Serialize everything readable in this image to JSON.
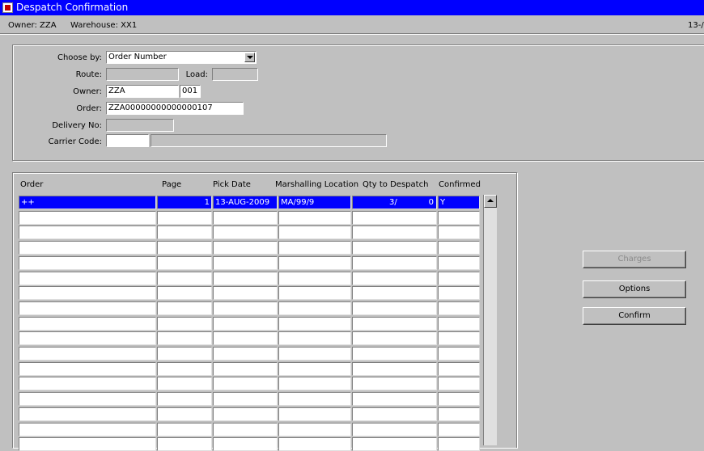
{
  "window": {
    "title": "Despatch Confirmation"
  },
  "info": {
    "owner_text": "Owner: ZZA",
    "warehouse_text": "Warehouse: XX1",
    "date_fragment": "13-/"
  },
  "form": {
    "choose_by_label": "Choose by:",
    "choose_by_value": "Order Number",
    "route_label": "Route:",
    "route_value": "",
    "load_label": "Load:",
    "load_value": "",
    "owner_label": "Owner:",
    "owner_value": "ZZA",
    "owner_code": "001",
    "order_label": "Order:",
    "order_value": "ZZA00000000000000107",
    "delivery_label": "Delivery No:",
    "delivery_value": "",
    "carrier_label": "Carrier Code:",
    "carrier_code": "",
    "carrier_desc": ""
  },
  "table": {
    "headers": [
      "Order",
      "Page",
      "Pick Date",
      "Marshalling Location",
      "Qty to Despatch",
      "Confirmed"
    ],
    "rows": [
      {
        "order": "++",
        "page": "1",
        "pick_date": "13-AUG-2009",
        "location": "MA/99/9",
        "qty": "3/",
        "qty2": "0",
        "confirmed": "Y"
      }
    ]
  },
  "buttons": {
    "charges": "Charges",
    "options": "Options",
    "confirm": "Confirm"
  },
  "colors": {
    "title_bg": "#0000ff",
    "selected_row": "#0000ff",
    "window_bg": "#c0c0c0"
  }
}
